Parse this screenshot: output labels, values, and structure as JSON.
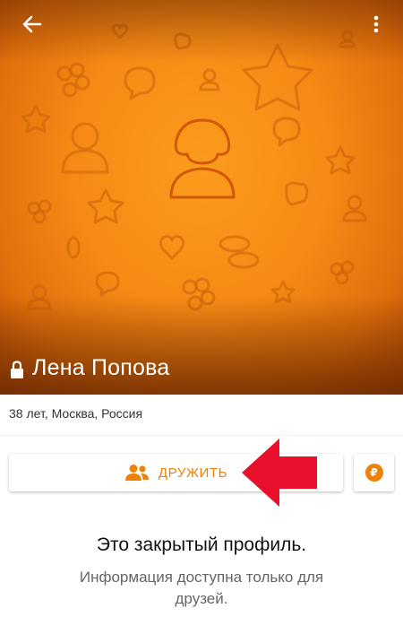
{
  "colors": {
    "accent": "#ee8208",
    "cover_base": "#f58a14",
    "cover_dark": "#b44d06",
    "annotation_arrow": "#e8102a"
  },
  "toolbar": {
    "back_icon": "arrow-back-icon",
    "menu_icon": "more-vertical-icon"
  },
  "profile": {
    "name": "Лена Попова",
    "details": "38 лет, Москва, Россия",
    "privacy_icon": "lock-icon",
    "avatar_icon": "female-silhouette-icon"
  },
  "actions": {
    "friend_label": "ДРУЖИТЬ",
    "friend_icon": "users-icon",
    "payment_icon": "ruble-icon",
    "payment_symbol": "₽"
  },
  "closed_profile": {
    "title": "Это закрытый профиль.",
    "text": "Информация доступна только для друзей."
  }
}
